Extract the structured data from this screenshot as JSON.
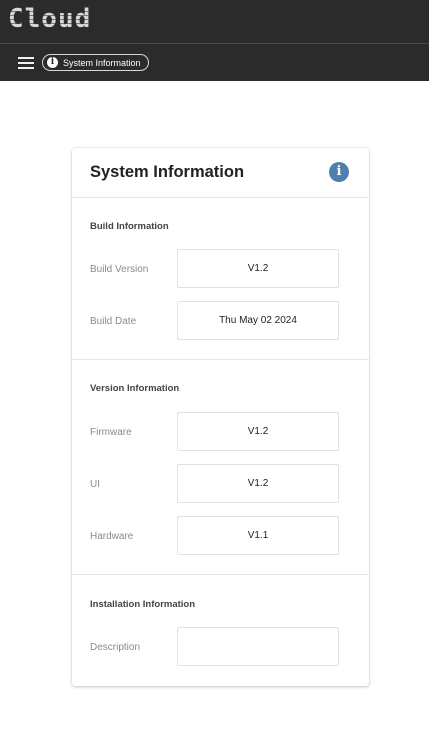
{
  "app": {
    "logo_text": "Cloud"
  },
  "nav": {
    "menu_icon": "hamburger-menu-icon",
    "chip": {
      "icon": "info-icon",
      "label": "System Information"
    }
  },
  "card": {
    "title": "System Information",
    "header_icon": "info-icon",
    "accent_color": "#4f7fae",
    "sections": {
      "build": {
        "title": "Build Information",
        "build_version_label": "Build Version",
        "build_version_value": "V1.2",
        "build_date_label": "Build Date",
        "build_date_value": "Thu May 02 2024"
      },
      "version": {
        "title": "Version Information",
        "firmware_label": "Firmware",
        "firmware_value": "V1.2",
        "ui_label": "UI",
        "ui_value": "V1.2",
        "hardware_label": "Hardware",
        "hardware_value": "V1.1"
      },
      "installation": {
        "title": "Installation Information",
        "description_label": "Description",
        "description_value": ""
      }
    }
  }
}
